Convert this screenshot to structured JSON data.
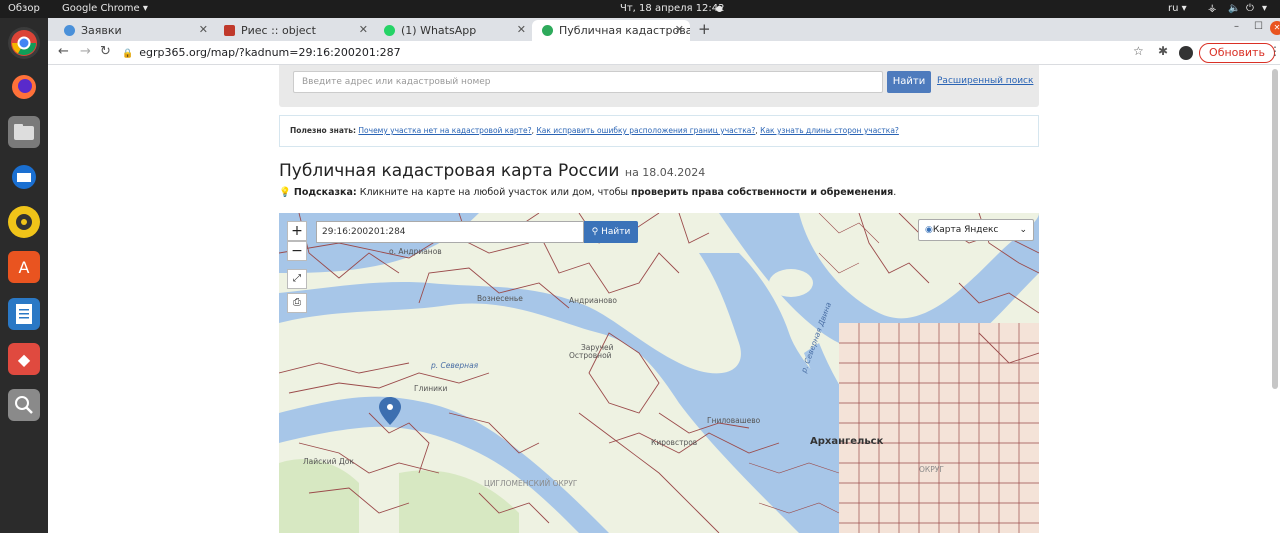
{
  "system_bar": {
    "overview": "Обзор",
    "app_menu": "Google Chrome ▾",
    "clock": "Чт, 18 апреля  12:42",
    "lang": "ru ▾"
  },
  "tabs": [
    {
      "label": "Заявки",
      "fav_color": "#4a90d9"
    },
    {
      "label": "Риес :: object",
      "fav_color": "#c0392b"
    },
    {
      "label": "(1) WhatsApp",
      "fav_color": "#25d366"
    },
    {
      "label": "Публичная кадастровая",
      "fav_color": "#2eaa5b"
    }
  ],
  "toolbar": {
    "url": "egrp365.org/map/?kadnum=29:16:200201:287",
    "update_label": "Обновить"
  },
  "search": {
    "placeholder": "Введите адрес или кадастровый номер",
    "button": "Найти",
    "advanced": "Расширенный поиск"
  },
  "tips": {
    "prefix": "Полезно знать:",
    "links": [
      "Почему участка нет на кадастровой карте?",
      "Как исправить ошибку расположения границ участка?",
      "Как узнать длины сторон участка?"
    ]
  },
  "page": {
    "title": "Публичная кадастровая карта России",
    "date": "на 18.04.2024",
    "hint_label": "Подсказка:",
    "hint_text": "Кликните на карте на любой участок или дом, чтобы",
    "hint_bold": "проверить права собственности и обременения",
    "hint_end": "."
  },
  "map": {
    "search_value": "29:16:200201:284",
    "search_button": "Найти",
    "layer": "Карта Яндекс",
    "labels": {
      "andrianov": "о. Андрианов",
      "voznesenie": "Вознесенье",
      "andrianovo": "Андрианово",
      "zaruchey": "Заручей",
      "ostrovnoy": "Островной",
      "gliniki": "Глиники",
      "severnaya": "р. Северная",
      "ladny": "Лайский Док",
      "tsiglomen": "ЦИГЛОМЕНСКИЙ ОКРУГ",
      "kirostrov": "Кировстров",
      "gnilovo": "Гниловашево",
      "arkhangelsk": "Архангельск",
      "dvina": "р. Северная Двина",
      "okrug": "ОКРУГ"
    }
  }
}
